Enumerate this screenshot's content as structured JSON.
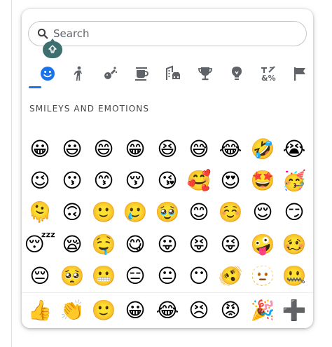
{
  "search": {
    "placeholder": "Search"
  },
  "categories": [
    {
      "id": "smileys",
      "icon": "smiley-icon",
      "active": true
    },
    {
      "id": "people",
      "icon": "person-icon"
    },
    {
      "id": "animals",
      "icon": "animal-icon"
    },
    {
      "id": "food",
      "icon": "food-icon"
    },
    {
      "id": "travel",
      "icon": "travel-icon"
    },
    {
      "id": "activities",
      "icon": "trophy-icon"
    },
    {
      "id": "objects",
      "icon": "lightbulb-icon"
    },
    {
      "id": "symbols",
      "icon": "symbols-icon"
    },
    {
      "id": "flags",
      "icon": "flag-icon"
    }
  ],
  "section": {
    "title": "SMILEYS AND EMOTIONS"
  },
  "colors": {
    "accent": "#1a73e8",
    "tooltip": "#3d6f70",
    "icon": "#5f6368",
    "emojiYellow": "#fbc02d"
  },
  "emoji_rows": [
    [
      "😀",
      "😃",
      "😄",
      "😁",
      "😆",
      "😅",
      "😂",
      "🤣",
      "😭"
    ],
    [
      "😉",
      "😗",
      "😙",
      "😚",
      "😘",
      "🥰",
      "😍",
      "🤩",
      "🥳"
    ],
    [
      "🫠",
      "🙃",
      "🙂",
      "🥲",
      "🥹",
      "😊",
      "☺️",
      "😌",
      "😏"
    ],
    [
      "😴",
      "😪",
      "🤤",
      "😋",
      "😛",
      "😝",
      "😜",
      "🤪",
      "🥴"
    ],
    [
      "😔",
      "🥺",
      "😬",
      "😑",
      "😐",
      "😶",
      "🫨",
      "🫥",
      "🤐"
    ],
    [
      "🫡",
      "🤔",
      "🤫",
      "🫢",
      "🤭",
      "🥱",
      "🤗",
      "🫣",
      "😱"
    ]
  ],
  "recent": [
    "👍",
    "👏",
    "🙂",
    "😀",
    "😂",
    "😣",
    "😡",
    "🎉",
    "➕"
  ]
}
